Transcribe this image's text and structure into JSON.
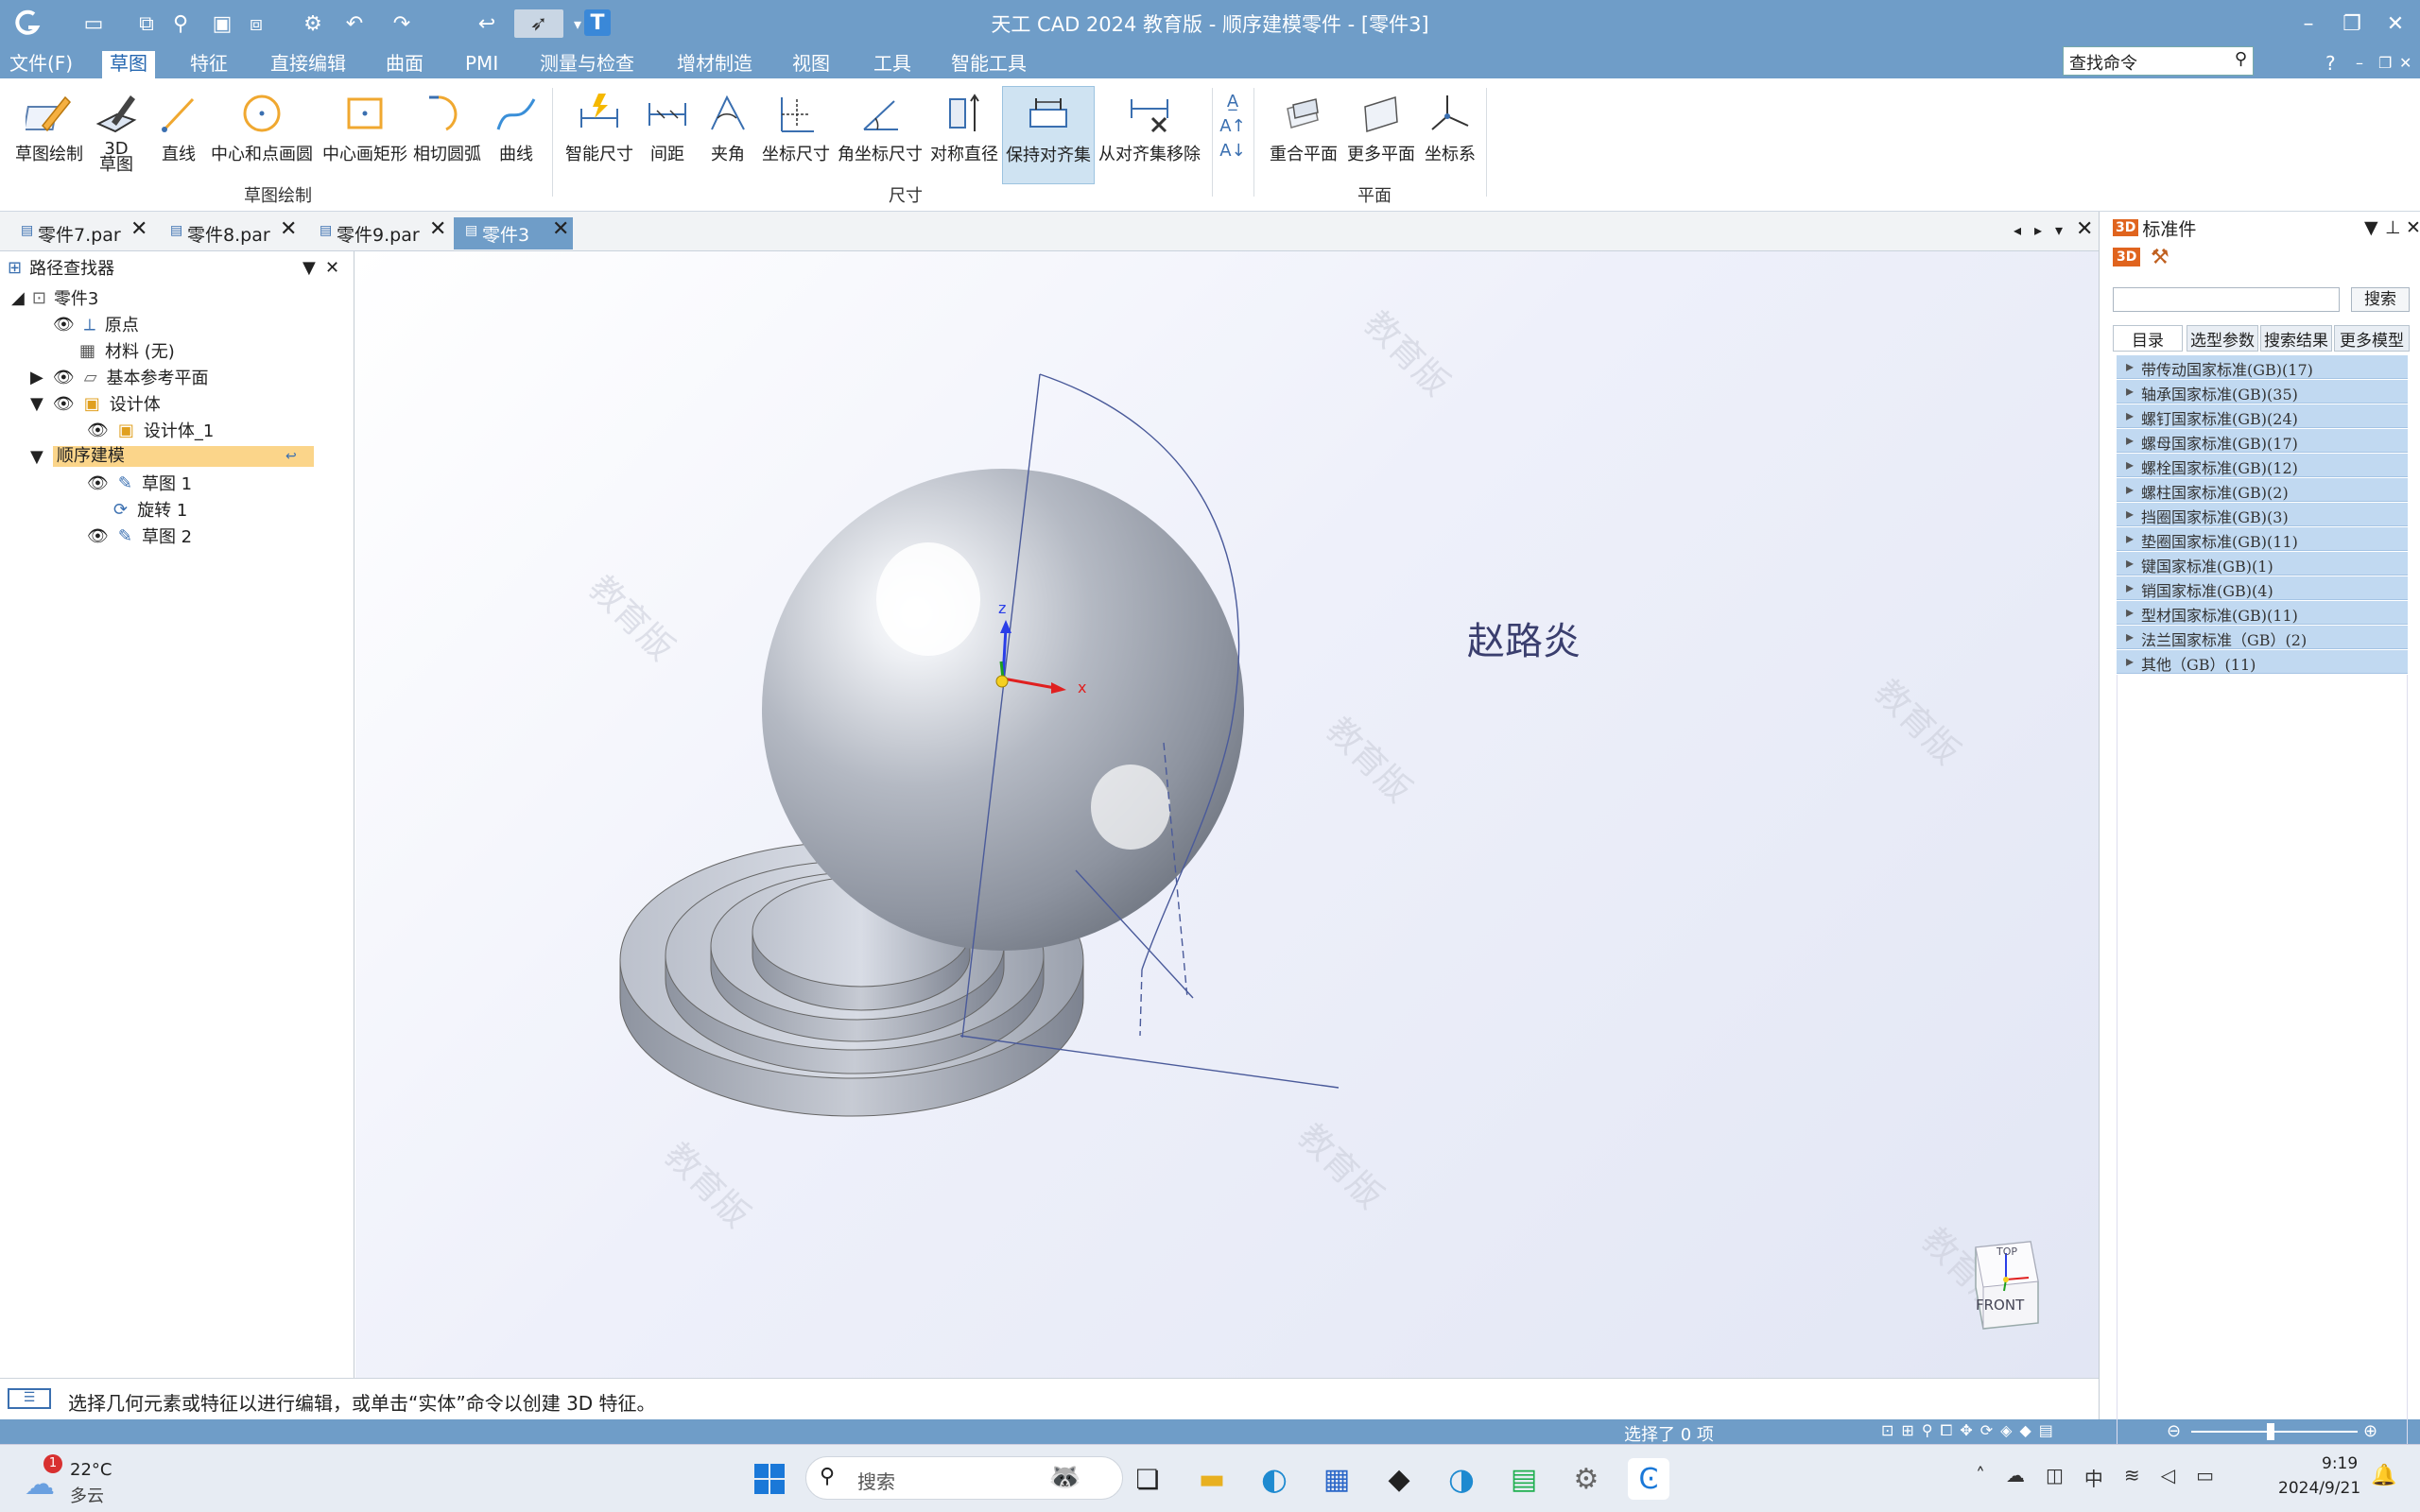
{
  "window": {
    "title": "天工 CAD 2024 教育版 - 顺序建模零件 - [零件3]"
  },
  "menubar": {
    "items": [
      "文件(F)",
      "草图",
      "特征",
      "直接编辑",
      "曲面",
      "PMI",
      "测量与检查",
      "增材制造",
      "视图",
      "工具",
      "智能工具"
    ],
    "active_index": 1,
    "search_placeholder": "查找命令",
    "help": "?"
  },
  "ribbon": {
    "buttons": [
      {
        "label": "草图绘制",
        "icon": "sketch-icon"
      },
      {
        "label": "3D\n草图",
        "icon": "3d-sketch-icon"
      },
      {
        "label": "直线",
        "icon": "line-icon"
      },
      {
        "label": "中心和点画圆",
        "icon": "circle-icon"
      },
      {
        "label": "中心画矩形",
        "icon": "rectangle-icon"
      },
      {
        "label": "相切圆弧",
        "icon": "arc-icon"
      },
      {
        "label": "曲线",
        "icon": "curve-icon"
      },
      {
        "label": "智能尺寸",
        "icon": "smart-dimension-icon"
      },
      {
        "label": "间距",
        "icon": "distance-icon"
      },
      {
        "label": "夹角",
        "icon": "angle-icon"
      },
      {
        "label": "坐标尺寸",
        "icon": "coordinate-dimension-icon"
      },
      {
        "label": "角坐标尺寸",
        "icon": "angular-coordinate-icon"
      },
      {
        "label": "对称直径",
        "icon": "symmetric-diameter-icon"
      },
      {
        "label": "保持对齐集",
        "icon": "keep-aligned-icon",
        "selected": true
      },
      {
        "label": "从对齐集移除",
        "icon": "remove-aligned-icon"
      },
      {
        "label": "重合平面",
        "icon": "coincident-plane-icon"
      },
      {
        "label": "更多平面",
        "icon": "more-planes-icon"
      },
      {
        "label": "坐标系",
        "icon": "coordinate-system-icon"
      }
    ],
    "groups": [
      "草图绘制",
      "尺寸",
      "平面"
    ]
  },
  "doc_tabs": [
    {
      "label": "零件7.par"
    },
    {
      "label": "零件8.par"
    },
    {
      "label": "零件9.par"
    },
    {
      "label": "零件3",
      "active": true
    }
  ],
  "pathfinder": {
    "title": "路径查找器",
    "items": [
      {
        "label": "零件3",
        "level": 0
      },
      {
        "label": "原点",
        "level": 1
      },
      {
        "label": "材料 (无)",
        "level": 1
      },
      {
        "label": "基本参考平面",
        "level": 1
      },
      {
        "label": "设计体",
        "level": 1
      },
      {
        "label": "设计体_1",
        "level": 2
      },
      {
        "label": "顺序建模",
        "level": 0,
        "highlighted": true
      },
      {
        "label": "草图 1",
        "level": 2
      },
      {
        "label": "旋转 1",
        "level": 2
      },
      {
        "label": "草图 2",
        "level": 2
      }
    ]
  },
  "viewport": {
    "annotation": "赵路炎",
    "axis_x": "x",
    "axis_z": "z",
    "view_cube_front": "FRONT",
    "view_cube_top": "TOP",
    "watermark": "教育版"
  },
  "status": {
    "message": "选择几何元素或特征以进行编辑，或单击“实体”命令以创建 3D 特征。",
    "selection": "选择了 0 项"
  },
  "library": {
    "title": "标准件",
    "search_button": "搜索",
    "tabs": [
      "目录",
      "选型参数",
      "搜索结果",
      "更多模型"
    ],
    "items": [
      "带传动国家标准(GB)(17)",
      "轴承国家标准(GB)(35)",
      "螺钉国家标准(GB)(24)",
      "螺母国家标准(GB)(17)",
      "螺栓国家标准(GB)(12)",
      "螺柱国家标准(GB)(2)",
      "挡圈国家标准(GB)(3)",
      "垫圈国家标准(GB)(11)",
      "键国家标准(GB)(1)",
      "销国家标准(GB)(4)",
      "型材国家标准(GB)(11)",
      "法兰国家标准（GB）(2)",
      "其他（GB）(11)"
    ]
  },
  "taskbar": {
    "weather_temp": "22°C",
    "weather_desc": "多云",
    "weather_badge": "1",
    "search_placeholder": "搜索",
    "ime": "中",
    "time": "9:19",
    "date": "2024/9/21"
  },
  "colors": {
    "title_blue": "#6f9dc8",
    "library_item": "#c1d9f1",
    "highlight": "#fbd58a"
  }
}
